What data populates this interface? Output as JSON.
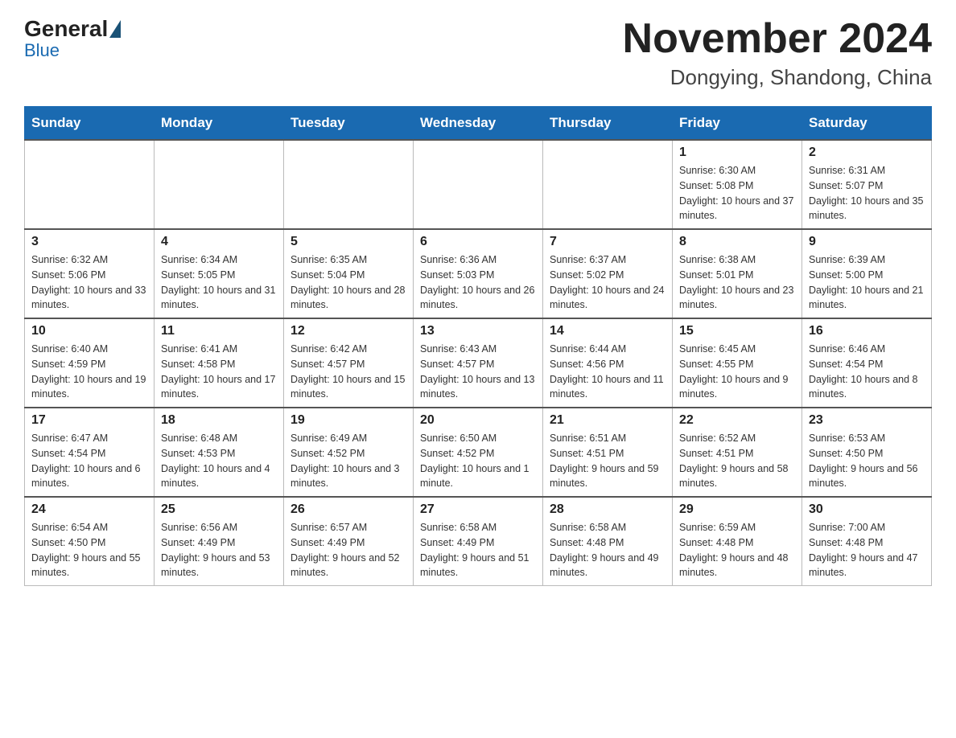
{
  "header": {
    "logo": {
      "general": "General",
      "blue": "Blue"
    },
    "title": "November 2024",
    "location": "Dongying, Shandong, China"
  },
  "weekdays": [
    "Sunday",
    "Monday",
    "Tuesday",
    "Wednesday",
    "Thursday",
    "Friday",
    "Saturday"
  ],
  "weeks": [
    [
      {
        "day": "",
        "info": ""
      },
      {
        "day": "",
        "info": ""
      },
      {
        "day": "",
        "info": ""
      },
      {
        "day": "",
        "info": ""
      },
      {
        "day": "",
        "info": ""
      },
      {
        "day": "1",
        "info": "Sunrise: 6:30 AM\nSunset: 5:08 PM\nDaylight: 10 hours and 37 minutes."
      },
      {
        "day": "2",
        "info": "Sunrise: 6:31 AM\nSunset: 5:07 PM\nDaylight: 10 hours and 35 minutes."
      }
    ],
    [
      {
        "day": "3",
        "info": "Sunrise: 6:32 AM\nSunset: 5:06 PM\nDaylight: 10 hours and 33 minutes."
      },
      {
        "day": "4",
        "info": "Sunrise: 6:34 AM\nSunset: 5:05 PM\nDaylight: 10 hours and 31 minutes."
      },
      {
        "day": "5",
        "info": "Sunrise: 6:35 AM\nSunset: 5:04 PM\nDaylight: 10 hours and 28 minutes."
      },
      {
        "day": "6",
        "info": "Sunrise: 6:36 AM\nSunset: 5:03 PM\nDaylight: 10 hours and 26 minutes."
      },
      {
        "day": "7",
        "info": "Sunrise: 6:37 AM\nSunset: 5:02 PM\nDaylight: 10 hours and 24 minutes."
      },
      {
        "day": "8",
        "info": "Sunrise: 6:38 AM\nSunset: 5:01 PM\nDaylight: 10 hours and 23 minutes."
      },
      {
        "day": "9",
        "info": "Sunrise: 6:39 AM\nSunset: 5:00 PM\nDaylight: 10 hours and 21 minutes."
      }
    ],
    [
      {
        "day": "10",
        "info": "Sunrise: 6:40 AM\nSunset: 4:59 PM\nDaylight: 10 hours and 19 minutes."
      },
      {
        "day": "11",
        "info": "Sunrise: 6:41 AM\nSunset: 4:58 PM\nDaylight: 10 hours and 17 minutes."
      },
      {
        "day": "12",
        "info": "Sunrise: 6:42 AM\nSunset: 4:57 PM\nDaylight: 10 hours and 15 minutes."
      },
      {
        "day": "13",
        "info": "Sunrise: 6:43 AM\nSunset: 4:57 PM\nDaylight: 10 hours and 13 minutes."
      },
      {
        "day": "14",
        "info": "Sunrise: 6:44 AM\nSunset: 4:56 PM\nDaylight: 10 hours and 11 minutes."
      },
      {
        "day": "15",
        "info": "Sunrise: 6:45 AM\nSunset: 4:55 PM\nDaylight: 10 hours and 9 minutes."
      },
      {
        "day": "16",
        "info": "Sunrise: 6:46 AM\nSunset: 4:54 PM\nDaylight: 10 hours and 8 minutes."
      }
    ],
    [
      {
        "day": "17",
        "info": "Sunrise: 6:47 AM\nSunset: 4:54 PM\nDaylight: 10 hours and 6 minutes."
      },
      {
        "day": "18",
        "info": "Sunrise: 6:48 AM\nSunset: 4:53 PM\nDaylight: 10 hours and 4 minutes."
      },
      {
        "day": "19",
        "info": "Sunrise: 6:49 AM\nSunset: 4:52 PM\nDaylight: 10 hours and 3 minutes."
      },
      {
        "day": "20",
        "info": "Sunrise: 6:50 AM\nSunset: 4:52 PM\nDaylight: 10 hours and 1 minute."
      },
      {
        "day": "21",
        "info": "Sunrise: 6:51 AM\nSunset: 4:51 PM\nDaylight: 9 hours and 59 minutes."
      },
      {
        "day": "22",
        "info": "Sunrise: 6:52 AM\nSunset: 4:51 PM\nDaylight: 9 hours and 58 minutes."
      },
      {
        "day": "23",
        "info": "Sunrise: 6:53 AM\nSunset: 4:50 PM\nDaylight: 9 hours and 56 minutes."
      }
    ],
    [
      {
        "day": "24",
        "info": "Sunrise: 6:54 AM\nSunset: 4:50 PM\nDaylight: 9 hours and 55 minutes."
      },
      {
        "day": "25",
        "info": "Sunrise: 6:56 AM\nSunset: 4:49 PM\nDaylight: 9 hours and 53 minutes."
      },
      {
        "day": "26",
        "info": "Sunrise: 6:57 AM\nSunset: 4:49 PM\nDaylight: 9 hours and 52 minutes."
      },
      {
        "day": "27",
        "info": "Sunrise: 6:58 AM\nSunset: 4:49 PM\nDaylight: 9 hours and 51 minutes."
      },
      {
        "day": "28",
        "info": "Sunrise: 6:58 AM\nSunset: 4:48 PM\nDaylight: 9 hours and 49 minutes."
      },
      {
        "day": "29",
        "info": "Sunrise: 6:59 AM\nSunset: 4:48 PM\nDaylight: 9 hours and 48 minutes."
      },
      {
        "day": "30",
        "info": "Sunrise: 7:00 AM\nSunset: 4:48 PM\nDaylight: 9 hours and 47 minutes."
      }
    ]
  ]
}
